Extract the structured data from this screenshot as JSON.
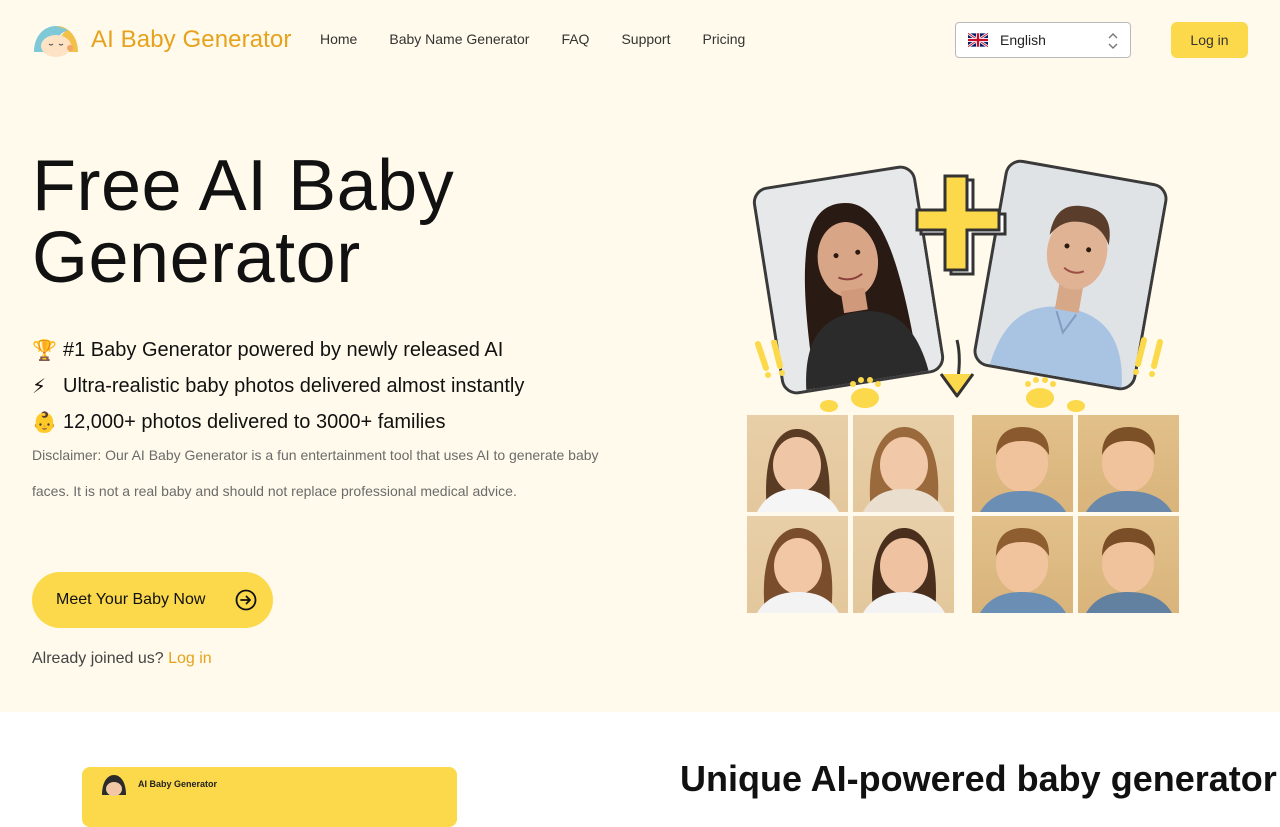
{
  "header": {
    "brand": "AI Baby Generator",
    "nav": [
      "Home",
      "Baby Name Generator",
      "FAQ",
      "Support",
      "Pricing"
    ],
    "language": "English",
    "login": "Log in"
  },
  "hero": {
    "title": "Free AI Baby Generator",
    "features": [
      {
        "icon": "trophy-icon",
        "glyph": "🏆",
        "text": "#1 Baby Generator powered by newly released AI"
      },
      {
        "icon": "lightning-icon",
        "glyph": "⚡",
        "text": "Ultra-realistic baby photos delivered almost instantly"
      },
      {
        "icon": "baby-icon",
        "glyph": "👶",
        "text": "12,000+ photos delivered to 3000+ families"
      }
    ],
    "disclaimer": "Disclaimer: Our AI Baby Generator is a fun entertainment tool that uses AI to generate baby faces. It is not a real baby and should not replace professional medical advice.",
    "cta": "Meet Your Baby Now",
    "joined_text": "Already joined us?",
    "joined_link": "Log in"
  },
  "lower": {
    "card_title": "AI Baby Generator",
    "heading": "Unique AI-powered baby generator"
  },
  "colors": {
    "accent": "#fcd94a",
    "brand_text": "#e6a21c",
    "hero_bg": "#fffaeb"
  }
}
